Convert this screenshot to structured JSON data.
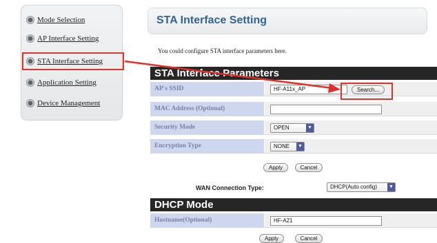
{
  "sidebar": {
    "items": [
      {
        "label": "Mode Selection"
      },
      {
        "label": "AP Interface Setting"
      },
      {
        "label": "STA Interface Setting"
      },
      {
        "label": "Application Setting"
      },
      {
        "label": "Device Management"
      }
    ],
    "selected_index": 2
  },
  "header": {
    "title": "STA Interface Setting"
  },
  "intro_text": "You could configure STA interface parameters here.",
  "sta": {
    "section_title": "STA Interface Parameters",
    "ssid_label": "AP's SSID",
    "ssid_value": "HF-A11x_AP",
    "search_label": "Search...",
    "mac_label": "MAC Address (Optional)",
    "mac_value": "",
    "security_label": "Security Mode",
    "security_value": "OPEN",
    "encryption_label": "Encryption Type",
    "encryption_value": "NONE",
    "apply_label": "Apply",
    "cancel_label": "Cancel"
  },
  "wan": {
    "label": "WAN Connection Type:",
    "value": "DHCP(Auto config)"
  },
  "dhcp": {
    "section_title": "DHCP Mode",
    "hostname_label": "Hostname(Optional)",
    "hostname_value": "HF-A21",
    "apply_label": "Apply",
    "cancel_label": "Cancel"
  },
  "colors": {
    "highlight": "#e0302a",
    "header_title": "#33638e",
    "section_bar": "#262626",
    "label_cell": "#cfd7ef"
  },
  "icons": {
    "nav_bullet": "radio-bullet-icon",
    "dropdown": "dropdown-arrow-icon",
    "annotation": "red-arrow-icon"
  }
}
